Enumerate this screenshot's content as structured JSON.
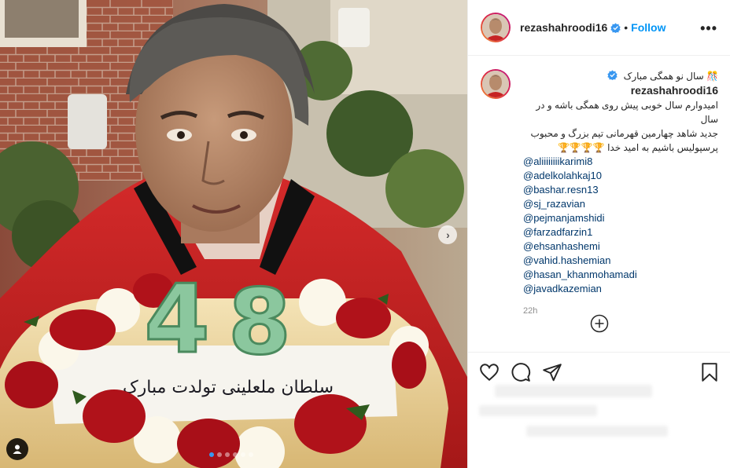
{
  "post": {
    "username": "rezashahroodi16",
    "follow_label": "Follow",
    "separator": "•",
    "more_label": "•••",
    "caption": {
      "username": "rezashahroodi16",
      "lines_fa": [
        "🎊 سال نو همگی مبارک",
        "امیدوارم سال خوبی پیش روی همگی باشه و در سال",
        "جدید شاهد چهارمین قهرمانی تیم بزرگ و محبوب",
        "پرسپولیس باشیم به امید خدا 🏆🏆🏆🏆"
      ],
      "mentions": [
        "@aliiiiiiiikarimi8",
        "@adelkolahkaj10",
        "@bashar.resn13",
        "@sj_razavian",
        "@pejmanjamshidi",
        "@farzadfarzin1",
        "@ehsanhashemi",
        "@vahid.hashemian",
        "@hasan_khanmohamadi",
        "@javadkazemian"
      ],
      "time": "22h"
    },
    "image": {
      "cake_number": "48",
      "cake_text_fa": "سلطان ملعلینی تولدت مبارک",
      "carousel_count": 6,
      "carousel_active_index": 0
    },
    "colors": {
      "accent": "#0095f6",
      "verified": "#3897f0",
      "text": "#262626",
      "muted": "#8e8e8e",
      "border": "#efefef"
    },
    "icons": [
      "verified-badge-icon",
      "more-options-icon",
      "add-comment-icon",
      "heart-icon",
      "comment-icon",
      "share-icon",
      "bookmark-icon",
      "user-tag-icon",
      "chevron-right-icon"
    ]
  }
}
